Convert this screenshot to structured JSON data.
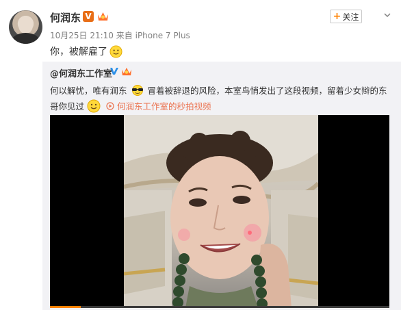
{
  "post": {
    "author": "何润东",
    "verified_badge": "V",
    "date": "10月25日 21:10",
    "source_prefix": "来自",
    "source": "iPhone 7 Plus",
    "text": "你，被解雇了",
    "follow_label": "关注"
  },
  "repost": {
    "author": "@何润东工作室",
    "text_before": "何以解忧，唯有润东",
    "text_after": "冒着被辞退的风险，本室鸟悄发出了这段视频，留着少女辫的东哥你见过",
    "link_text": "何润东工作室的秒拍视频"
  },
  "video": {
    "progress": 0.09,
    "accent_color": "#ff8200"
  },
  "colors": {
    "link": "#eb7350",
    "badge": "#e86e17",
    "repost_bg": "#f2f2f5"
  },
  "icons": [
    "avatar",
    "verified-v-icon",
    "vip-crown-icon",
    "chevron-down-icon",
    "smile-emoji-icon",
    "cool-sunglasses-emoji-icon",
    "video-link-icon"
  ]
}
